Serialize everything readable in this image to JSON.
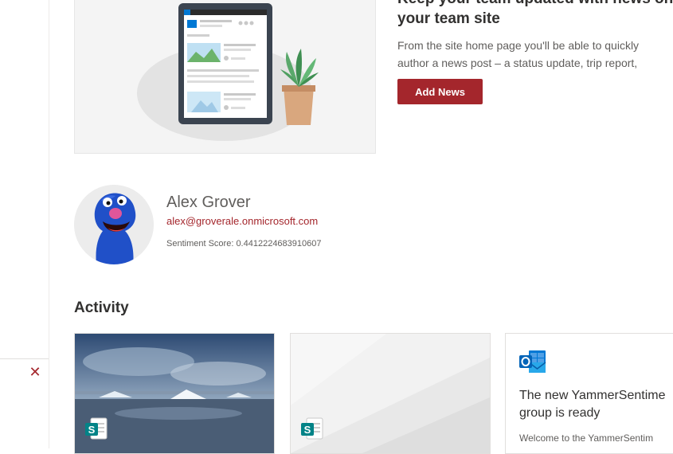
{
  "news": {
    "title_line1": "Keep your team updated with news on",
    "title_line2": "your team site",
    "desc_line1": "From the site home page you'll be able to quickly",
    "desc_line2": "author a news post – a status update, trip report,",
    "add_button": "Add News"
  },
  "person": {
    "name": "Alex Grover",
    "email": "alex@groverale.onmicrosoft.com",
    "score_label": "Sentiment Score:",
    "score_value": "0.4412224683910607"
  },
  "activity": {
    "title": "Activity",
    "cards": [
      {
        "type": "sharepoint-page",
        "icon": "sharepoint-icon"
      },
      {
        "type": "sharepoint-page",
        "icon": "sharepoint-icon"
      },
      {
        "type": "outlook-group",
        "icon": "outlook-icon",
        "title_line1": "The new YammerSentime",
        "title_line2": "group is ready",
        "body": "Welcome to the YammerSentim"
      }
    ]
  },
  "colors": {
    "accent": "#a4262c",
    "text": "#323130",
    "muted": "#605e5c"
  }
}
